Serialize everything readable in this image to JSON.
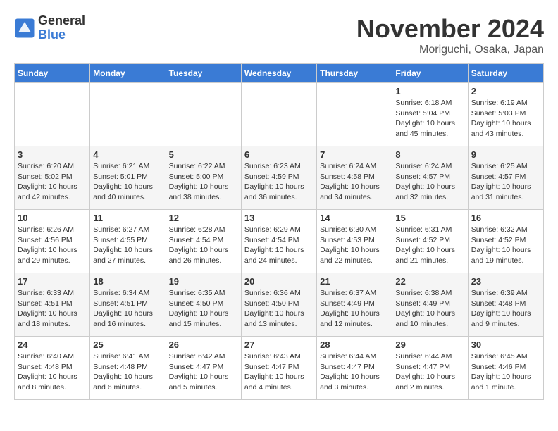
{
  "logo": {
    "general": "General",
    "blue": "Blue"
  },
  "header": {
    "month": "November 2024",
    "location": "Moriguchi, Osaka, Japan"
  },
  "weekdays": [
    "Sunday",
    "Monday",
    "Tuesday",
    "Wednesday",
    "Thursday",
    "Friday",
    "Saturday"
  ],
  "weeks": [
    [
      {
        "day": "",
        "detail": ""
      },
      {
        "day": "",
        "detail": ""
      },
      {
        "day": "",
        "detail": ""
      },
      {
        "day": "",
        "detail": ""
      },
      {
        "day": "",
        "detail": ""
      },
      {
        "day": "1",
        "detail": "Sunrise: 6:18 AM\nSunset: 5:04 PM\nDaylight: 10 hours\nand 45 minutes."
      },
      {
        "day": "2",
        "detail": "Sunrise: 6:19 AM\nSunset: 5:03 PM\nDaylight: 10 hours\nand 43 minutes."
      }
    ],
    [
      {
        "day": "3",
        "detail": "Sunrise: 6:20 AM\nSunset: 5:02 PM\nDaylight: 10 hours\nand 42 minutes."
      },
      {
        "day": "4",
        "detail": "Sunrise: 6:21 AM\nSunset: 5:01 PM\nDaylight: 10 hours\nand 40 minutes."
      },
      {
        "day": "5",
        "detail": "Sunrise: 6:22 AM\nSunset: 5:00 PM\nDaylight: 10 hours\nand 38 minutes."
      },
      {
        "day": "6",
        "detail": "Sunrise: 6:23 AM\nSunset: 4:59 PM\nDaylight: 10 hours\nand 36 minutes."
      },
      {
        "day": "7",
        "detail": "Sunrise: 6:24 AM\nSunset: 4:58 PM\nDaylight: 10 hours\nand 34 minutes."
      },
      {
        "day": "8",
        "detail": "Sunrise: 6:24 AM\nSunset: 4:57 PM\nDaylight: 10 hours\nand 32 minutes."
      },
      {
        "day": "9",
        "detail": "Sunrise: 6:25 AM\nSunset: 4:57 PM\nDaylight: 10 hours\nand 31 minutes."
      }
    ],
    [
      {
        "day": "10",
        "detail": "Sunrise: 6:26 AM\nSunset: 4:56 PM\nDaylight: 10 hours\nand 29 minutes."
      },
      {
        "day": "11",
        "detail": "Sunrise: 6:27 AM\nSunset: 4:55 PM\nDaylight: 10 hours\nand 27 minutes."
      },
      {
        "day": "12",
        "detail": "Sunrise: 6:28 AM\nSunset: 4:54 PM\nDaylight: 10 hours\nand 26 minutes."
      },
      {
        "day": "13",
        "detail": "Sunrise: 6:29 AM\nSunset: 4:54 PM\nDaylight: 10 hours\nand 24 minutes."
      },
      {
        "day": "14",
        "detail": "Sunrise: 6:30 AM\nSunset: 4:53 PM\nDaylight: 10 hours\nand 22 minutes."
      },
      {
        "day": "15",
        "detail": "Sunrise: 6:31 AM\nSunset: 4:52 PM\nDaylight: 10 hours\nand 21 minutes."
      },
      {
        "day": "16",
        "detail": "Sunrise: 6:32 AM\nSunset: 4:52 PM\nDaylight: 10 hours\nand 19 minutes."
      }
    ],
    [
      {
        "day": "17",
        "detail": "Sunrise: 6:33 AM\nSunset: 4:51 PM\nDaylight: 10 hours\nand 18 minutes."
      },
      {
        "day": "18",
        "detail": "Sunrise: 6:34 AM\nSunset: 4:51 PM\nDaylight: 10 hours\nand 16 minutes."
      },
      {
        "day": "19",
        "detail": "Sunrise: 6:35 AM\nSunset: 4:50 PM\nDaylight: 10 hours\nand 15 minutes."
      },
      {
        "day": "20",
        "detail": "Sunrise: 6:36 AM\nSunset: 4:50 PM\nDaylight: 10 hours\nand 13 minutes."
      },
      {
        "day": "21",
        "detail": "Sunrise: 6:37 AM\nSunset: 4:49 PM\nDaylight: 10 hours\nand 12 minutes."
      },
      {
        "day": "22",
        "detail": "Sunrise: 6:38 AM\nSunset: 4:49 PM\nDaylight: 10 hours\nand 10 minutes."
      },
      {
        "day": "23",
        "detail": "Sunrise: 6:39 AM\nSunset: 4:48 PM\nDaylight: 10 hours\nand 9 minutes."
      }
    ],
    [
      {
        "day": "24",
        "detail": "Sunrise: 6:40 AM\nSunset: 4:48 PM\nDaylight: 10 hours\nand 8 minutes."
      },
      {
        "day": "25",
        "detail": "Sunrise: 6:41 AM\nSunset: 4:48 PM\nDaylight: 10 hours\nand 6 minutes."
      },
      {
        "day": "26",
        "detail": "Sunrise: 6:42 AM\nSunset: 4:47 PM\nDaylight: 10 hours\nand 5 minutes."
      },
      {
        "day": "27",
        "detail": "Sunrise: 6:43 AM\nSunset: 4:47 PM\nDaylight: 10 hours\nand 4 minutes."
      },
      {
        "day": "28",
        "detail": "Sunrise: 6:44 AM\nSunset: 4:47 PM\nDaylight: 10 hours\nand 3 minutes."
      },
      {
        "day": "29",
        "detail": "Sunrise: 6:44 AM\nSunset: 4:47 PM\nDaylight: 10 hours\nand 2 minutes."
      },
      {
        "day": "30",
        "detail": "Sunrise: 6:45 AM\nSunset: 4:46 PM\nDaylight: 10 hours\nand 1 minute."
      }
    ]
  ]
}
